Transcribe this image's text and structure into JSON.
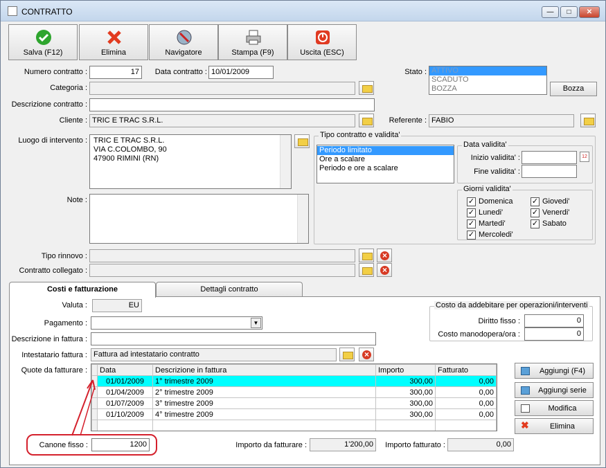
{
  "window": {
    "title": "CONTRATTO",
    "minimize": "—",
    "maximize": "□",
    "close": "✕"
  },
  "toolbar": {
    "save": "Salva (F12)",
    "delete": "Elimina",
    "navigator": "Navigatore",
    "print": "Stampa (F9)",
    "exit": "Uscita (ESC)"
  },
  "header": {
    "numero_label": "Numero contratto :",
    "numero_value": "17",
    "data_label": "Data contratto :",
    "data_value": "10/01/2009",
    "stato_label": "Stato :",
    "stato_options": [
      "ATTIVO",
      "SCADUTO",
      "BOZZA"
    ],
    "bozza_button": "Bozza",
    "categoria_label": "Categoria :",
    "categoria_value": "",
    "descrizione_label": "Descrizione contratto :",
    "descrizione_value": "",
    "cliente_label": "Cliente :",
    "cliente_value": "TRIC E TRAC S.R.L.",
    "referente_label": "Referente :",
    "referente_value": "FABIO",
    "luogo_label": "Luogo di intervento :",
    "luogo_lines": [
      "TRIC E TRAC S.R.L.",
      "VIA C.COLOMBO, 90",
      "47900 RIMINI (RN)"
    ],
    "note_label": "Note :",
    "tipo_rinnovo_label": "Tipo rinnovo :",
    "contratto_collegato_label": "Contratto collegato :"
  },
  "tipo_contratto": {
    "title": "Tipo contratto e validita'",
    "options": [
      "Periodo limitato",
      "Ore a scalare",
      "Periodo e ore a scalare"
    ],
    "data_validita_title": "Data validita'",
    "inizio_label": "Inizio validita' :",
    "fine_label": "Fine validita' :",
    "giorni_title": "Giorni validita'",
    "giorni_col1": [
      "Domenica",
      "Lunedi'",
      "Martedi'",
      "Mercoledi'"
    ],
    "giorni_col2": [
      "Giovedi'",
      "Venerdi'",
      "Sabato"
    ]
  },
  "tabs": {
    "tab1": "Costi e fatturazione",
    "tab2": "Dettagli contratto"
  },
  "costi": {
    "valuta_label": "Valuta :",
    "valuta_value": "EU",
    "pagamento_label": "Pagamento :",
    "descrizione_fattura_label": "Descrizione in fattura :",
    "intestatario_label": "Intestatario fattura :",
    "intestatario_value": "Fattura ad intestatario contratto",
    "quote_label": "Quote da fatturare :",
    "costo_group_title": "Costo da addebitare per operazioni/interventi",
    "diritto_label": "Diritto fisso :",
    "diritto_value": "0",
    "manodopera_label": "Costo manodopera/ora :",
    "manodopera_value": "0",
    "canone_label": "Canone fisso :",
    "canone_value": "1200",
    "importo_da_label": "Importo da fatturare :",
    "importo_da_value": "1'200,00",
    "importo_fatt_label": "Importo fatturato :",
    "importo_fatt_value": "0,00"
  },
  "quote_table": {
    "columns": [
      "Data",
      "Descrizione in fattura",
      "Importo",
      "Fatturato"
    ],
    "rows": [
      [
        "01/01/2009",
        "1° trimestre 2009",
        "300,00",
        "0,00"
      ],
      [
        "01/04/2009",
        "2° trimestre 2009",
        "300,00",
        "0,00"
      ],
      [
        "01/07/2009",
        "3° trimestre 2009",
        "300,00",
        "0,00"
      ],
      [
        "01/10/2009",
        "4° trimestre 2009",
        "300,00",
        "0,00"
      ]
    ]
  },
  "side_buttons": {
    "aggiungi": "Aggiungi (F4)",
    "aggiungi_serie": "Aggiungi serie",
    "modifica": "Modifica",
    "elimina": "Elimina"
  },
  "colors": {
    "highlight_row": "#00ffff",
    "annotation": "#d4202c",
    "selection": "#3399ff"
  }
}
